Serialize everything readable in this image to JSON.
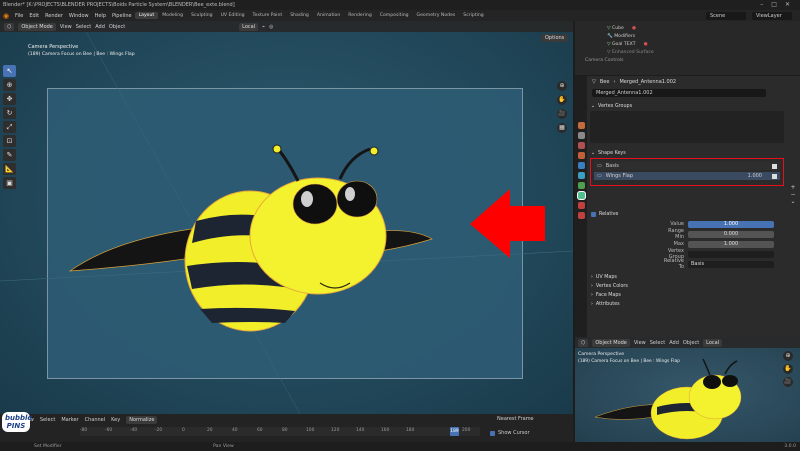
{
  "titlebar": {
    "title": "Blender* [K:\\PROJECTS\\BLENDER PROJECTS\\Boids Particle System\\BLENDER\\Bee_exte.blend]"
  },
  "menubar": {
    "items": [
      "File",
      "Edit",
      "Render",
      "Window",
      "Help",
      "Pipeline"
    ],
    "workspaces": [
      "Layout",
      "Modeling",
      "Sculpting",
      "UV Editing",
      "Texture Paint",
      "Shading",
      "Animation",
      "Rendering",
      "Compositing",
      "Geometry Nodes",
      "Scripting"
    ],
    "scene": "Scene",
    "view_layer": "ViewLayer"
  },
  "viewport": {
    "mode": "Object Mode",
    "menu": [
      "View",
      "Select",
      "Add",
      "Object"
    ],
    "orientation": "Local",
    "options": "Options",
    "info_line1": "Camera Perspective",
    "info_line2": "(189) Camera Focus on Bee | Bee : Wings Flap"
  },
  "outliner": {
    "rows": [
      "Cube",
      "Modifiers",
      "Goal TEXT",
      "Enhanced Surface",
      "Camera Controls"
    ]
  },
  "properties": {
    "object": "Bee",
    "data_name": "Merged_Antenna1.002",
    "mesh_name": "Merged_Antenna1.002",
    "vertex_groups": "Vertex Groups",
    "shape_keys": "Shape Keys",
    "keys": [
      {
        "name": "Basis",
        "value": ""
      },
      {
        "name": "Wings Flap",
        "value": "1.000"
      }
    ],
    "relative": "Relative",
    "value_label": "Value",
    "value": "1.000",
    "range_min_label": "Range Min",
    "range_min": "0.000",
    "max_label": "Max",
    "max": "1.000",
    "vertex_group_label": "Vertex Group",
    "relative_to_label": "Relative To",
    "relative_to": "Basis",
    "uv_maps": "UV Maps",
    "vertex_colors": "Vertex Colors",
    "face_maps": "Face Maps",
    "attributes": "Attributes"
  },
  "mini_viewport": {
    "mode": "Object Mode",
    "menu": [
      "View",
      "Select",
      "Add",
      "Object"
    ],
    "orientation": "Local",
    "info_line1": "Camera Perspective",
    "info_line2": "(189) Camera Focus on Bee | Bee : Wings Flap"
  },
  "timeline": {
    "menu": [
      "View",
      "Select",
      "Marker",
      "Channel",
      "Key"
    ],
    "normalize": "Normalize",
    "ticks": [
      "-80",
      "-60",
      "-40",
      "-20",
      "0",
      "20",
      "40",
      "60",
      "80",
      "100",
      "120",
      "140",
      "160",
      "180",
      "200"
    ],
    "current_frame": "189",
    "nearest_frame": "Nearest Frame",
    "show_cursor": "Show Cursor"
  },
  "statusbar": {
    "left": "Set Modifier",
    "center": "Pan View",
    "version": "3.0.0"
  },
  "logo": {
    "line1": "bubble",
    "line2": "PINS"
  },
  "colors": {
    "accent": "#4772b3",
    "arrow": "#ff0000",
    "highlight_box": "#e5101a",
    "bee_yellow": "#f2ee2a"
  }
}
